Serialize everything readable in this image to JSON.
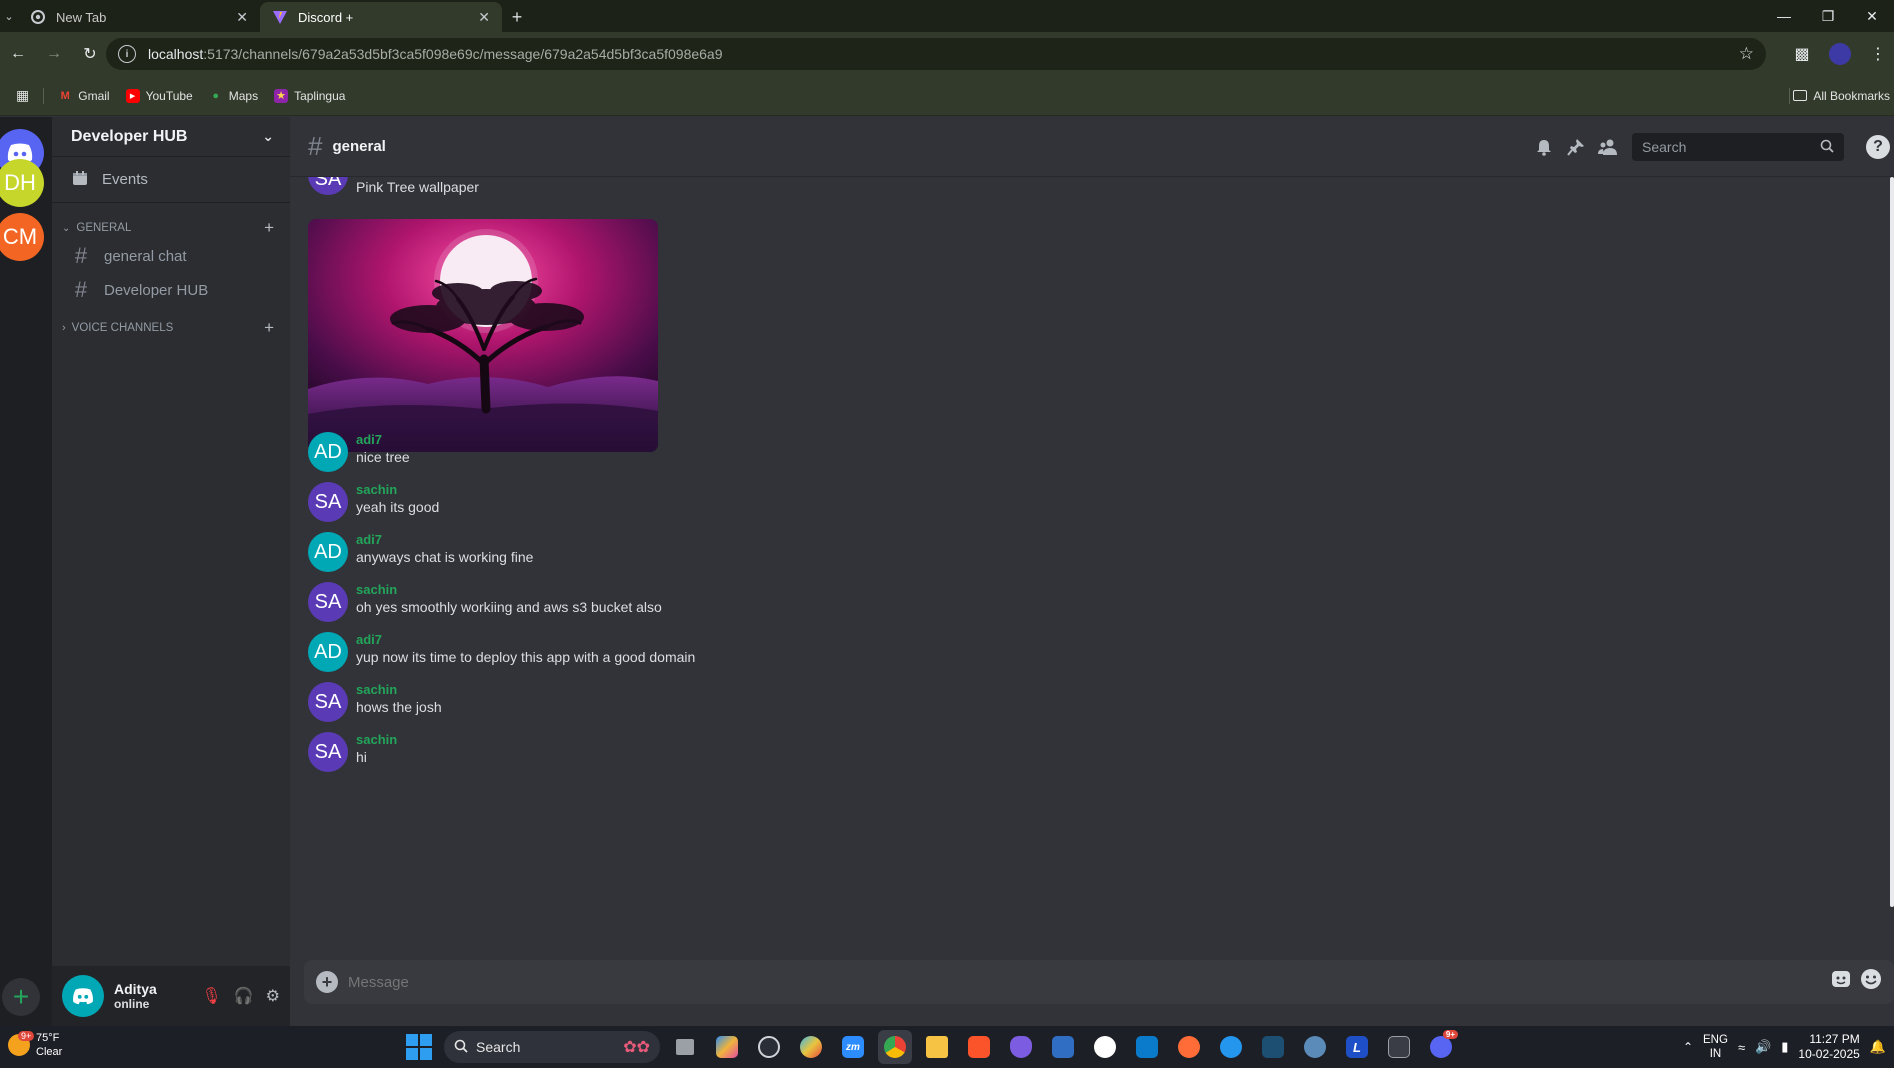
{
  "browser": {
    "tabs": [
      {
        "title": "New Tab",
        "active": false
      },
      {
        "title": "Discord +",
        "active": true
      }
    ],
    "url_host": "localhost",
    "url_rest": ":5173/channels/679a2a53d5bf3ca5f098e69c/message/679a2a54d5bf3ca5f098e6a9",
    "bookmarks": [
      "Gmail",
      "YouTube",
      "Maps",
      "Taplingua"
    ],
    "all_bookmarks": "All Bookmarks"
  },
  "rail": {
    "servers": [
      {
        "label": "DH",
        "color": "#c6d62b"
      },
      {
        "label": "CM",
        "color": "#f26522"
      }
    ],
    "add": "+"
  },
  "sidebar": {
    "server_name": "Developer HUB",
    "events_label": "Events",
    "categories": [
      {
        "name": "GENERAL",
        "channels": [
          "general chat",
          "Developer HUB"
        ]
      },
      {
        "name": "VOICE CHANNELS",
        "channels": []
      }
    ]
  },
  "user": {
    "name": "Aditya",
    "status": "online"
  },
  "channel": {
    "name": "general",
    "search_placeholder": "Search"
  },
  "messages": {
    "first": {
      "avatar": "SA",
      "text": "Pink Tree wallpaper"
    },
    "list": [
      {
        "avatar": "AD",
        "author": "adi7",
        "text": "nice tree"
      },
      {
        "avatar": "SA",
        "author": "sachin",
        "text": "yeah its good"
      },
      {
        "avatar": "AD",
        "author": "adi7",
        "text": "anyways chat is working fine"
      },
      {
        "avatar": "SA",
        "author": "sachin",
        "text": "oh yes smoothly workiing and aws s3 bucket also"
      },
      {
        "avatar": "AD",
        "author": "adi7",
        "text": "yup now its time to deploy this app with a good domain"
      },
      {
        "avatar": "SA",
        "author": "sachin",
        "text": "hows the josh"
      },
      {
        "avatar": "SA",
        "author": "sachin",
        "text": "hi"
      }
    ],
    "avatar_colors": {
      "AD": "#00a8b5",
      "SA": "#5b3bb5"
    }
  },
  "composer": {
    "placeholder": "Message"
  },
  "taskbar": {
    "weather_temp": "75°F",
    "weather_desc": "Clear",
    "weather_badge": "9+",
    "search_label": "Search",
    "lang_1": "ENG",
    "lang_2": "IN",
    "time": "11:27 PM",
    "date": "10-02-2025",
    "discord_badge": "9+"
  },
  "colors": {
    "accent_green": "#23a55a",
    "discord_blurple": "#5865f2",
    "background": "#313338"
  }
}
